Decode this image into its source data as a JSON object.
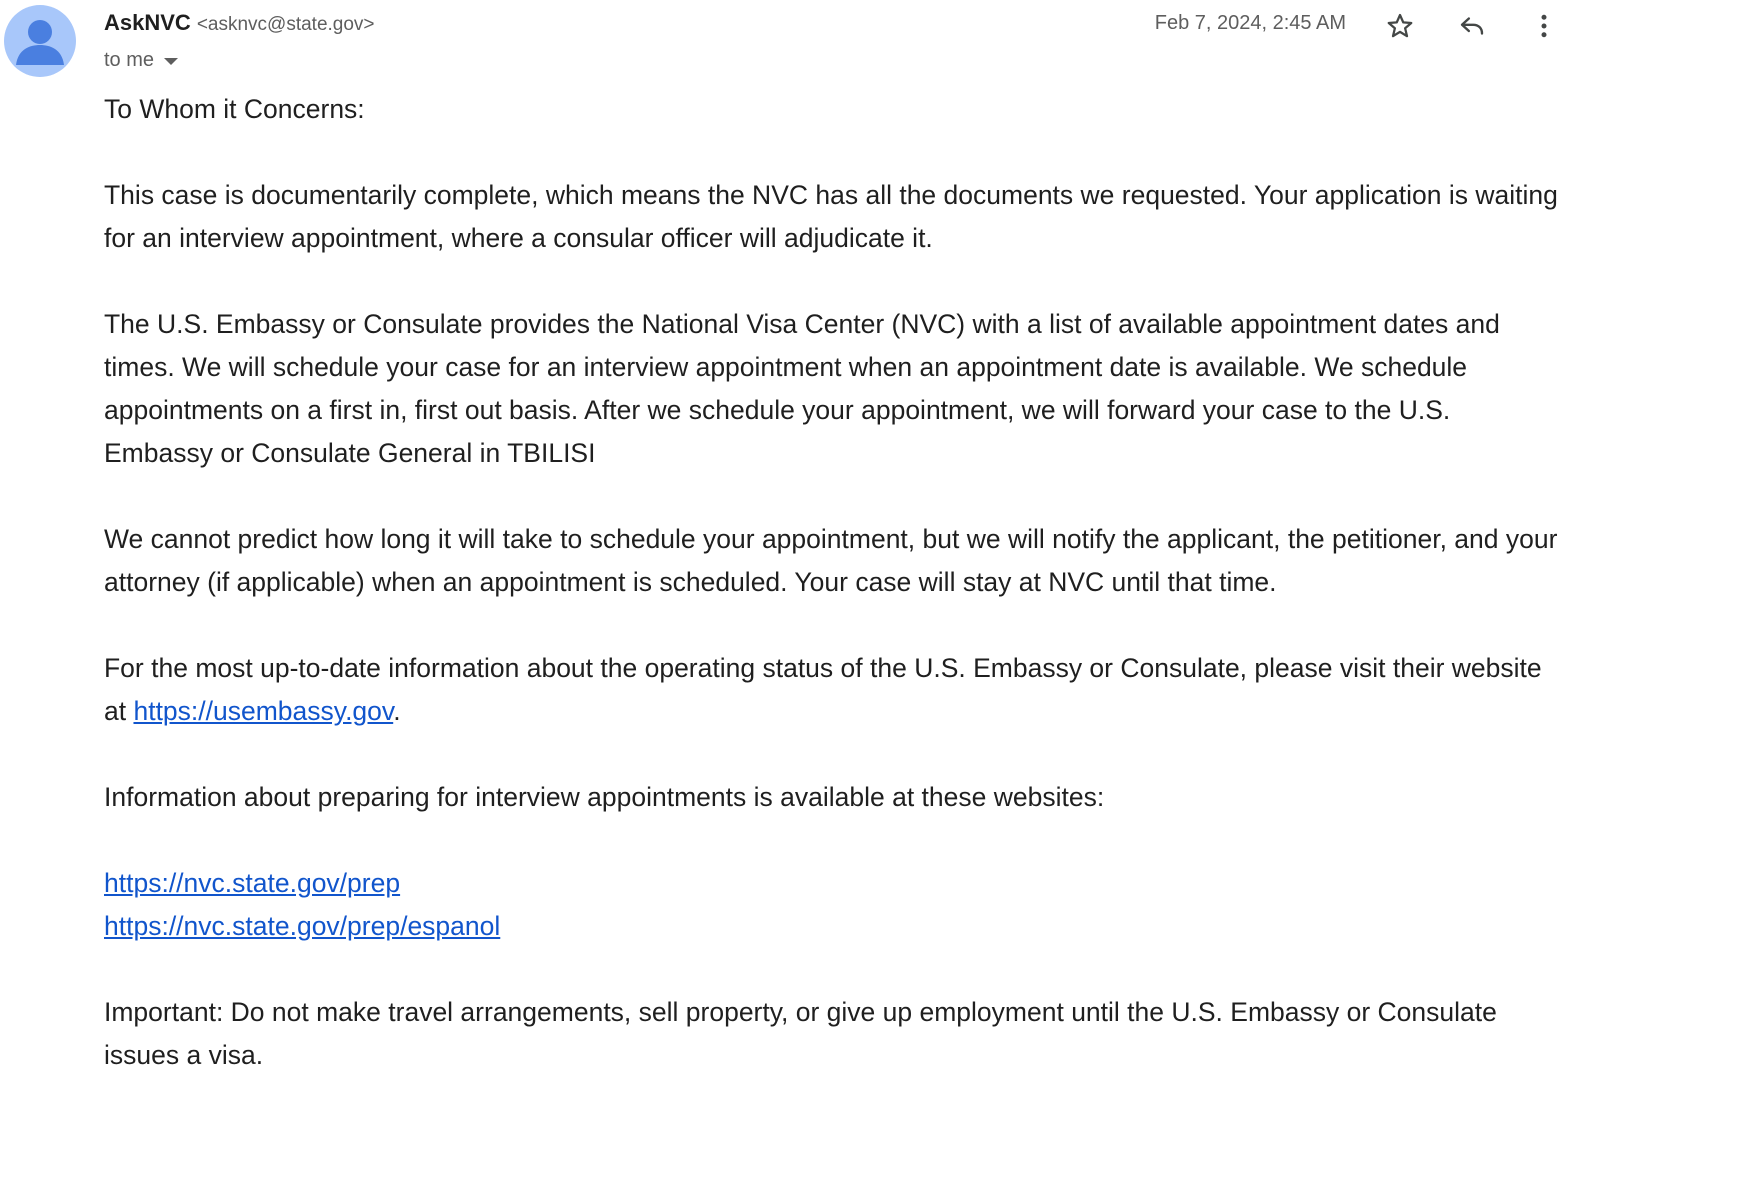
{
  "sender": {
    "name": "AskNVC",
    "email": "<asknvc@state.gov>",
    "avatar_icon": "person-icon",
    "avatar_color": "#a8c7fa",
    "avatar_figure_color": "#4a7fe0"
  },
  "recipient": {
    "label": "to me"
  },
  "date": "Feb 7, 2024, 2:45 AM",
  "actions": {
    "star_icon": "star-icon",
    "reply_icon": "reply-icon",
    "more_icon": "more-vert-icon"
  },
  "body": {
    "greeting": "To Whom it Concerns:",
    "p1": "This case is documentarily complete, which means the NVC has all the documents we requested. Your application is waiting for an interview appointment, where a consular officer will adjudicate it.",
    "p2": "The U.S. Embassy or Consulate provides the National Visa Center (NVC) with a list of available appointment dates and times.  We will schedule your case for an interview appointment when an appointment date is available.  We schedule appointments on a first in, first out basis.  After we schedule your appointment, we will forward your case to the U.S. Embassy or Consulate General in TBILISI",
    "p3": "We cannot predict how long it will take to schedule your appointment, but we will notify the applicant, the petitioner, and your attorney (if applicable) when an appointment is scheduled.  Your case will stay at NVC until that time.",
    "p4_prefix": "For the most up-to-date information about the operating status of the U.S. Embassy or Consulate, please visit their website at ",
    "p4_link": "https://usembassy.gov",
    "p4_suffix": ".",
    "p5": "Information about preparing for interview appointments is available at these websites:",
    "link1": "https://nvc.state.gov/prep",
    "link2": "https://nvc.state.gov/prep/espanol",
    "p6": "Important: Do not make travel arrangements, sell property, or give up employment until the U.S. Embassy or Consulate issues a visa."
  },
  "colors": {
    "link": "#1155cc",
    "text": "#1f1f1f",
    "muted": "#5e5e5e"
  }
}
